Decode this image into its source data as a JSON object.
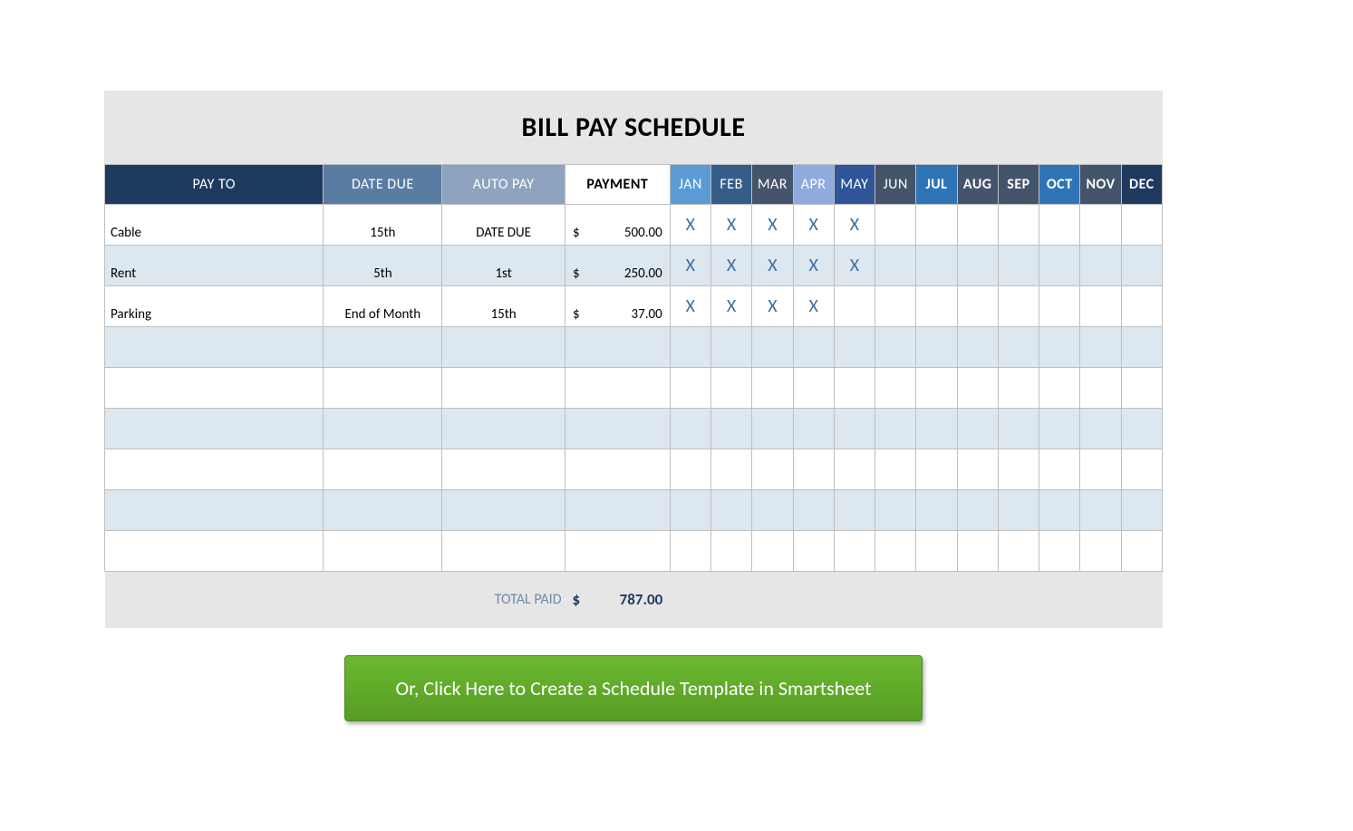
{
  "title": "BILL PAY SCHEDULE",
  "columns": {
    "payto": "PAY TO",
    "due": "DATE DUE",
    "auto": "AUTO PAY",
    "payment": "PAYMENT",
    "months": [
      "JAN",
      "FEB",
      "MAR",
      "APR",
      "MAY",
      "JUN",
      "JUL",
      "AUG",
      "SEP",
      "OCT",
      "NOV",
      "DEC"
    ]
  },
  "rows": [
    {
      "payto": "Cable",
      "due": "15th",
      "auto": "DATE DUE",
      "currency": "$",
      "amount": "500.00",
      "marks": [
        "X",
        "X",
        "X",
        "X",
        "X",
        "",
        "",
        "",
        "",
        "",
        "",
        ""
      ]
    },
    {
      "payto": "Rent",
      "due": "5th",
      "auto": "1st",
      "currency": "$",
      "amount": "250.00",
      "marks": [
        "X",
        "X",
        "X",
        "X",
        "X",
        "",
        "",
        "",
        "",
        "",
        "",
        ""
      ]
    },
    {
      "payto": "Parking",
      "due": "End of Month",
      "auto": "15th",
      "currency": "$",
      "amount": "37.00",
      "marks": [
        "X",
        "X",
        "X",
        "X",
        "",
        "",
        "",
        "",
        "",
        "",
        "",
        ""
      ]
    },
    {
      "payto": "",
      "due": "",
      "auto": "",
      "currency": "",
      "amount": "",
      "marks": [
        "",
        "",
        "",
        "",
        "",
        "",
        "",
        "",
        "",
        "",
        "",
        ""
      ]
    },
    {
      "payto": "",
      "due": "",
      "auto": "",
      "currency": "",
      "amount": "",
      "marks": [
        "",
        "",
        "",
        "",
        "",
        "",
        "",
        "",
        "",
        "",
        "",
        ""
      ]
    },
    {
      "payto": "",
      "due": "",
      "auto": "",
      "currency": "",
      "amount": "",
      "marks": [
        "",
        "",
        "",
        "",
        "",
        "",
        "",
        "",
        "",
        "",
        "",
        ""
      ]
    },
    {
      "payto": "",
      "due": "",
      "auto": "",
      "currency": "",
      "amount": "",
      "marks": [
        "",
        "",
        "",
        "",
        "",
        "",
        "",
        "",
        "",
        "",
        "",
        ""
      ]
    },
    {
      "payto": "",
      "due": "",
      "auto": "",
      "currency": "",
      "amount": "",
      "marks": [
        "",
        "",
        "",
        "",
        "",
        "",
        "",
        "",
        "",
        "",
        "",
        ""
      ]
    },
    {
      "payto": "",
      "due": "",
      "auto": "",
      "currency": "",
      "amount": "",
      "marks": [
        "",
        "",
        "",
        "",
        "",
        "",
        "",
        "",
        "",
        "",
        "",
        ""
      ]
    }
  ],
  "total": {
    "label": "TOTAL PAID",
    "currency": "$",
    "amount": "787.00"
  },
  "cta": "Or, Click Here to Create a Schedule Template in Smartsheet",
  "month_header_classes": [
    "h-jan",
    "h-feb",
    "h-mar",
    "h-apr",
    "h-may",
    "h-jun",
    "h-jul",
    "h-aug",
    "h-sep",
    "h-oct",
    "h-nov",
    "h-dec"
  ]
}
